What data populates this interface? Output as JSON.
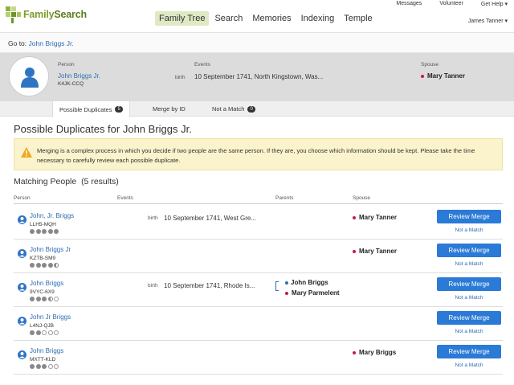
{
  "header": {
    "logo_text_a": "Family",
    "logo_text_b": "Search",
    "nav": [
      "Family Tree",
      "Search",
      "Memories",
      "Indexing",
      "Temple"
    ],
    "util": [
      "Messages",
      "Volunteer",
      "Get Help ▾"
    ],
    "user": "James Tanner ▾"
  },
  "goto": {
    "label": "Go to:",
    "link": "John Briggs Jr."
  },
  "person": {
    "person_label": "Person",
    "name": "John Briggs Jr.",
    "id": "K4JK-CCQ",
    "events_label": "Events",
    "event_type": "birth",
    "event_value": "10 September 1741, North Kingstown, Was...",
    "spouse_label": "Spouse",
    "spouse": "Mary Tanner"
  },
  "tabs": [
    {
      "label": "Possible Duplicates",
      "badge": "5"
    },
    {
      "label": "Merge by ID",
      "badge": ""
    },
    {
      "label": "Not a Match",
      "badge": "0"
    }
  ],
  "title": "Possible Duplicates for John Briggs Jr.",
  "warning": "Merging is a complex process in which you decide if two people are the same person. If they are, you choose which information should be kept. Please take the time necessary to carefully review each possible duplicate.",
  "matching": {
    "title": "Matching People",
    "count": "(5 results)"
  },
  "columns": [
    "Person",
    "Events",
    "Parents",
    "Spouse"
  ],
  "review_label": "Review Merge",
  "not_match_label": "Not a Match",
  "rows": [
    {
      "name": "John, Jr. Briggs",
      "id": "LLH5-MQH",
      "quality": [
        1,
        1,
        1,
        1,
        1
      ],
      "event_type": "birth",
      "event": "10 September 1741, West Gre...",
      "father": "",
      "mother": "",
      "spouse": "Mary Tanner"
    },
    {
      "name": "John Briggs Jr",
      "id": "KZTB-SM9",
      "quality": [
        1,
        1,
        1,
        1,
        0.5
      ],
      "event_type": "",
      "event": "",
      "father": "",
      "mother": "",
      "spouse": "Mary Tanner"
    },
    {
      "name": "John Briggs",
      "id": "9VYC-6X9",
      "quality": [
        1,
        1,
        1,
        0.5,
        0
      ],
      "event_type": "birth",
      "event": "10 September 1741, Rhode Is...",
      "father": "John Briggs",
      "mother": "Mary Parmelent",
      "spouse": ""
    },
    {
      "name": "John Jr Briggs",
      "id": "L4NJ-QJB",
      "quality": [
        1,
        1,
        0,
        0,
        0
      ],
      "event_type": "",
      "event": "",
      "father": "",
      "mother": "",
      "spouse": ""
    },
    {
      "name": "John Briggs",
      "id": "MXTT-KLD",
      "quality": [
        1,
        1,
        1,
        0,
        0
      ],
      "event_type": "",
      "event": "",
      "father": "",
      "mother": "",
      "spouse": "Mary Briggs"
    }
  ]
}
